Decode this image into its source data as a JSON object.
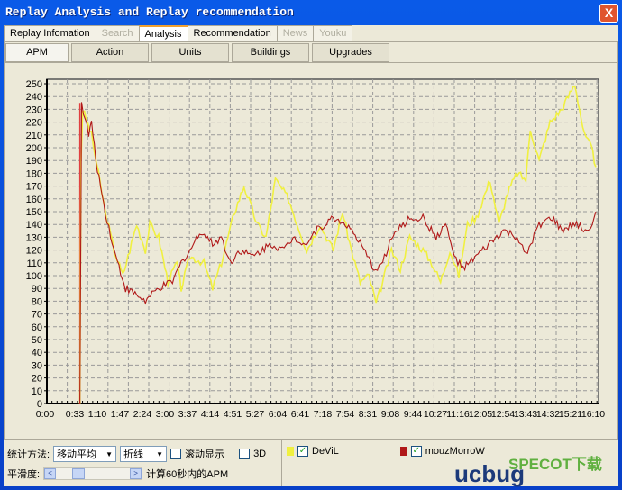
{
  "window": {
    "title": "Replay Analysis and Replay recommendation",
    "close": "X"
  },
  "tabs": [
    {
      "label": "Replay Infomation",
      "state": "normal"
    },
    {
      "label": "Search",
      "state": "disabled"
    },
    {
      "label": "Analysis",
      "state": "active"
    },
    {
      "label": "Recommendation",
      "state": "normal"
    },
    {
      "label": "News",
      "state": "disabled"
    },
    {
      "label": "Youku",
      "state": "disabled"
    }
  ],
  "subtabs": [
    {
      "label": "APM",
      "active": true
    },
    {
      "label": "Action"
    },
    {
      "label": "Units"
    },
    {
      "label": "Buildings"
    },
    {
      "label": "Upgrades"
    }
  ],
  "chart_data": {
    "type": "line",
    "ylim": [
      0,
      250
    ],
    "yticks": [
      0,
      10,
      20,
      30,
      40,
      50,
      60,
      70,
      80,
      90,
      100,
      110,
      120,
      130,
      140,
      150,
      160,
      170,
      180,
      190,
      200,
      210,
      220,
      230,
      240,
      250
    ],
    "xticklabels": [
      "0:00",
      "0:33",
      "1:10",
      "1:47",
      "2:24",
      "3:00",
      "3:37",
      "4:14",
      "4:51",
      "5:27",
      "6:04",
      "6:41",
      "7:18",
      "7:54",
      "8:31",
      "9:08",
      "9:44",
      "10:27",
      "11:16",
      "12:05",
      "12:54",
      "13:43",
      "14:32",
      "15:21",
      "16:10"
    ],
    "xlim": [
      "0:00",
      "16:37"
    ],
    "grid": true,
    "series": [
      {
        "name": "DeViL",
        "color": "#f0f040",
        "points": [
          [
            "1:00",
            0
          ],
          [
            "1:02",
            190
          ],
          [
            "1:05",
            230
          ],
          [
            "1:21",
            210
          ],
          [
            "1:46",
            150
          ],
          [
            "2:02",
            120
          ],
          [
            "2:18",
            100
          ],
          [
            "2:43",
            140
          ],
          [
            "2:59",
            120
          ],
          [
            "3:07",
            140
          ],
          [
            "3:23",
            130
          ],
          [
            "3:40",
            95
          ],
          [
            "3:56",
            110
          ],
          [
            "4:04",
            90
          ],
          [
            "4:20",
            115
          ],
          [
            "4:45",
            110
          ],
          [
            "5:01",
            90
          ],
          [
            "5:17",
            110
          ],
          [
            "5:41",
            150
          ],
          [
            "5:58",
            170
          ],
          [
            "6:22",
            140
          ],
          [
            "6:38",
            130
          ],
          [
            "6:55",
            175
          ],
          [
            "7:19",
            160
          ],
          [
            "7:35",
            140
          ],
          [
            "7:52",
            120
          ],
          [
            "8:16",
            140
          ],
          [
            "8:40",
            120
          ],
          [
            "8:57",
            150
          ],
          [
            "9:13",
            120
          ],
          [
            "9:29",
            95
          ],
          [
            "9:45",
            100
          ],
          [
            "9:58",
            78
          ],
          [
            "10:10",
            95
          ],
          [
            "10:26",
            120
          ],
          [
            "10:42",
            105
          ],
          [
            "10:59",
            130
          ],
          [
            "11:23",
            120
          ],
          [
            "11:39",
            110
          ],
          [
            "11:55",
            95
          ],
          [
            "12:12",
            120
          ],
          [
            "12:28",
            100
          ],
          [
            "12:44",
            140
          ],
          [
            "13:00",
            145
          ],
          [
            "13:25",
            175
          ],
          [
            "13:41",
            140
          ],
          [
            "13:57",
            165
          ],
          [
            "14:14",
            180
          ],
          [
            "14:30",
            175
          ],
          [
            "14:38",
            215
          ],
          [
            "14:54",
            190
          ],
          [
            "15:14",
            220
          ],
          [
            "15:35",
            230
          ],
          [
            "15:59",
            250
          ],
          [
            "16:16",
            210
          ],
          [
            "16:29",
            200
          ],
          [
            "16:37",
            185
          ]
        ]
      },
      {
        "name": "mouzMorroW",
        "color": "#b01818",
        "points": [
          [
            "1:00",
            0
          ],
          [
            "1:03",
            235
          ],
          [
            "1:16",
            210
          ],
          [
            "1:21",
            220
          ],
          [
            "1:29",
            190
          ],
          [
            "1:46",
            150
          ],
          [
            "2:02",
            120
          ],
          [
            "2:23",
            90
          ],
          [
            "2:43",
            85
          ],
          [
            "2:59",
            80
          ],
          [
            "3:23",
            90
          ],
          [
            "3:48",
            95
          ],
          [
            "4:04",
            110
          ],
          [
            "4:20",
            120
          ],
          [
            "4:40",
            135
          ],
          [
            "5:01",
            125
          ],
          [
            "5:17",
            130
          ],
          [
            "5:33",
            110
          ],
          [
            "5:50",
            120
          ],
          [
            "6:14",
            115
          ],
          [
            "6:47",
            125
          ],
          [
            "7:11",
            120
          ],
          [
            "7:27",
            130
          ],
          [
            "7:52",
            125
          ],
          [
            "8:08",
            135
          ],
          [
            "8:40",
            145
          ],
          [
            "9:05",
            140
          ],
          [
            "9:29",
            125
          ],
          [
            "9:54",
            105
          ],
          [
            "10:10",
            110
          ],
          [
            "10:26",
            130
          ],
          [
            "10:59",
            145
          ],
          [
            "11:23",
            145
          ],
          [
            "11:47",
            130
          ],
          [
            "12:04",
            140
          ],
          [
            "12:20",
            115
          ],
          [
            "12:36",
            105
          ],
          [
            "13:00",
            115
          ],
          [
            "13:25",
            125
          ],
          [
            "13:49",
            135
          ],
          [
            "14:14",
            130
          ],
          [
            "14:30",
            115
          ],
          [
            "14:54",
            140
          ],
          [
            "15:18",
            145
          ],
          [
            "15:35",
            135
          ],
          [
            "15:59",
            140
          ],
          [
            "16:24",
            135
          ],
          [
            "16:37",
            150
          ]
        ]
      }
    ]
  },
  "controls": {
    "method_label": "统计方法:",
    "method_value": "移动平均",
    "type_value": "折线",
    "scroll_label": "滚动显示",
    "3d_label": "3D",
    "smooth_label": "平滑度:",
    "smooth_desc": "计算60秒内的APM"
  },
  "legend": [
    {
      "name": "DeViL",
      "color": "#f0f040",
      "checked": true
    },
    {
      "name": "mouzMorroW",
      "color": "#b01818",
      "checked": true
    }
  ],
  "watermark": {
    "text1": "ucbug",
    "text2": "SPECOT下载"
  }
}
